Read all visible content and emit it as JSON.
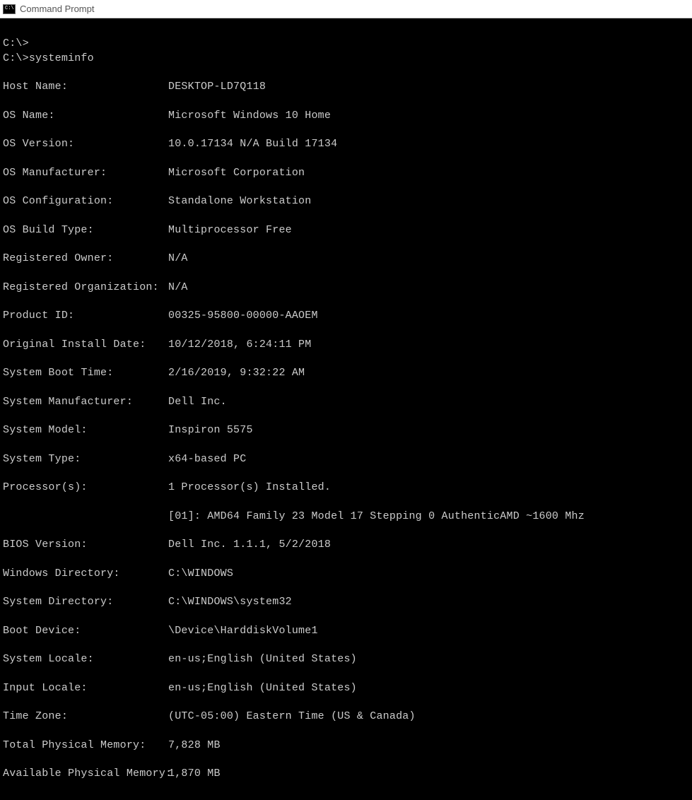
{
  "window": {
    "title": "Command Prompt"
  },
  "prompt": {
    "line1": "C:\\>",
    "line2_prefix": "C:\\>",
    "command": "systeminfo"
  },
  "fields": [
    {
      "label": "Host Name:",
      "value": "DESKTOP-LD7Q118"
    },
    {
      "label": "OS Name:",
      "value": "Microsoft Windows 10 Home"
    },
    {
      "label": "OS Version:",
      "value": "10.0.17134 N/A Build 17134"
    },
    {
      "label": "OS Manufacturer:",
      "value": "Microsoft Corporation"
    },
    {
      "label": "OS Configuration:",
      "value": "Standalone Workstation"
    },
    {
      "label": "OS Build Type:",
      "value": "Multiprocessor Free"
    },
    {
      "label": "Registered Owner:",
      "value": "N/A"
    },
    {
      "label": "Registered Organization:",
      "value": "N/A"
    },
    {
      "label": "Product ID:",
      "value": "00325-95800-00000-AAOEM"
    },
    {
      "label": "Original Install Date:",
      "value": "10/12/2018, 6:24:11 PM"
    },
    {
      "label": "System Boot Time:",
      "value": "2/16/2019, 9:32:22 AM"
    },
    {
      "label": "System Manufacturer:",
      "value": "Dell Inc."
    },
    {
      "label": "System Model:",
      "value": "Inspiron 5575"
    },
    {
      "label": "System Type:",
      "value": "x64-based PC"
    },
    {
      "label": "Processor(s):",
      "value": "1 Processor(s) Installed."
    }
  ],
  "processor_sub": {
    "value": "[01]: AMD64 Family 23 Model 17 Stepping 0 AuthenticAMD ~1600 Mhz"
  },
  "fields2": [
    {
      "label": "BIOS Version:",
      "value": "Dell Inc. 1.1.1, 5/2/2018"
    },
    {
      "label": "Windows Directory:",
      "value": "C:\\WINDOWS"
    },
    {
      "label": "System Directory:",
      "value": "C:\\WINDOWS\\system32"
    },
    {
      "label": "Boot Device:",
      "value": "\\Device\\HarddiskVolume1"
    },
    {
      "label": "System Locale:",
      "value": "en-us;English (United States)"
    },
    {
      "label": "Input Locale:",
      "value": "en-us;English (United States)"
    },
    {
      "label": "Time Zone:",
      "value": "(UTC-05:00) Eastern Time (US & Canada)"
    },
    {
      "label": "Total Physical Memory:",
      "value": "7,828 MB"
    },
    {
      "label": "Available Physical Memory:",
      "value": "1,870 MB"
    }
  ]
}
